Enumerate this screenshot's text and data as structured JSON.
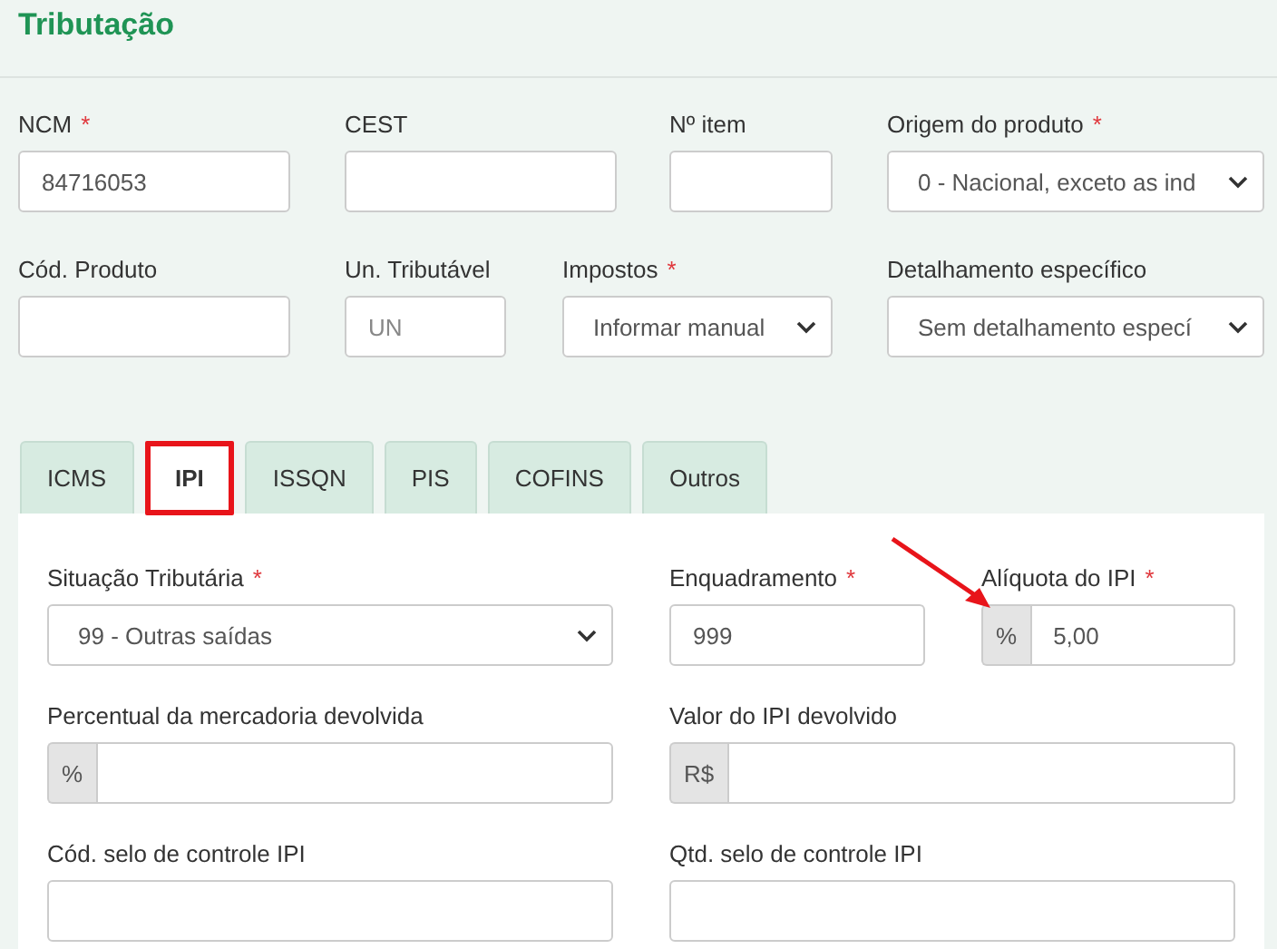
{
  "header": {
    "title": "Tributação"
  },
  "rows": [
    [
      {
        "label": "NCM",
        "required_mark": "*",
        "kind": "text",
        "value": "84716053"
      },
      {
        "label": "CEST",
        "kind": "text"
      },
      {
        "label": "Nº item",
        "kind": "text"
      },
      {
        "label": "Origem do produto",
        "required_mark": "*",
        "kind": "select",
        "value": "0 - Nacional, exceto as ind"
      }
    ],
    [
      {
        "label": "Cód. Produto",
        "kind": "text"
      },
      {
        "label": "Un. Tributável",
        "kind": "text",
        "placeholder": "UN"
      },
      {
        "label": "Impostos",
        "required_mark": "*",
        "kind": "select",
        "value": "Informar manual"
      },
      {
        "label": "Detalhamento específico",
        "kind": "select",
        "value": "Sem detalhamento especí"
      }
    ]
  ],
  "tabs": [
    {
      "label": "ICMS",
      "selected": false,
      "highlighted": false
    },
    {
      "label": "IPI",
      "selected": true,
      "highlighted": true
    },
    {
      "label": "ISSQN",
      "selected": false,
      "highlighted": false
    },
    {
      "label": "PIS",
      "selected": false,
      "highlighted": false
    },
    {
      "label": "COFINS",
      "selected": false,
      "highlighted": false
    },
    {
      "label": "Outros",
      "selected": false,
      "highlighted": false
    }
  ],
  "panel_rows": [
    [
      {
        "label": "Situação Tributária",
        "required_mark": "*",
        "kind": "select",
        "value": "99 - Outras saídas"
      },
      {
        "label": "Enquadramento",
        "required_mark": "*",
        "kind": "text",
        "value": "999"
      },
      {
        "label": "Alíquota do IPI",
        "required_mark": "*",
        "kind": "addon",
        "prefix": "%",
        "value": "5,00",
        "arrow": true
      }
    ],
    [
      {
        "label": "Percentual da mercadoria devolvida",
        "kind": "addon",
        "prefix": "%"
      },
      {
        "label": "Valor do IPI devolvido",
        "kind": "addon",
        "prefix": "R$"
      }
    ],
    [
      {
        "label": "Cód. selo de controle IPI",
        "kind": "text"
      },
      {
        "label": "Qtd. selo de controle IPI",
        "kind": "text"
      }
    ]
  ]
}
